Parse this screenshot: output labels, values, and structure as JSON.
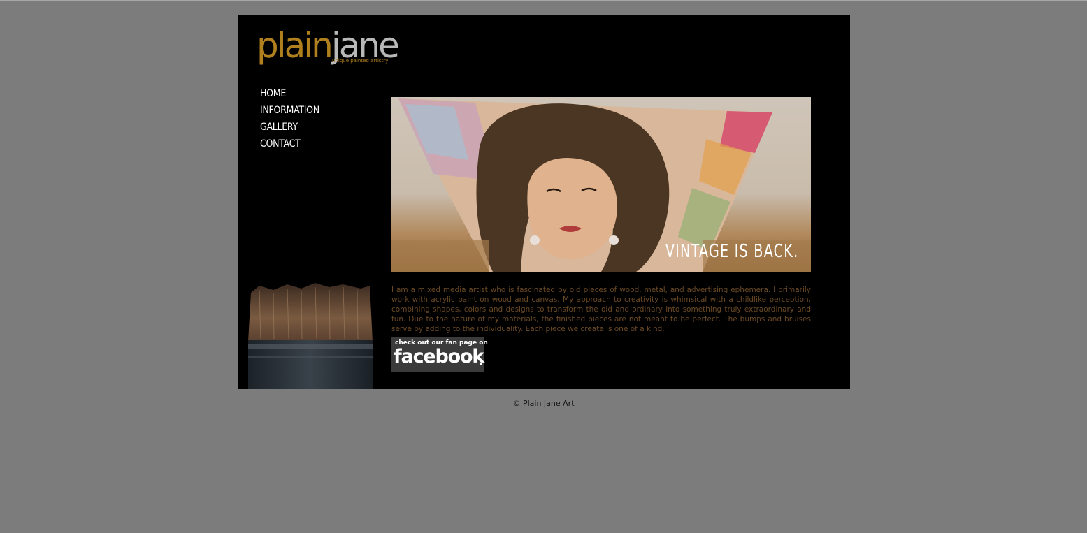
{
  "logo": {
    "word_plain": "plain",
    "word_jane": "jane",
    "tagline": "unique painted artistry"
  },
  "nav": {
    "items": [
      {
        "label": "HOME"
      },
      {
        "label": "INFORMATION"
      },
      {
        "label": "GALLERY"
      },
      {
        "label": "CONTACT"
      }
    ]
  },
  "hero": {
    "caption": "VINTAGE IS BACK."
  },
  "intro": {
    "text": "I am a mixed media artist who is fascinated by old pieces of wood, metal, and advertising ephemera. I primarily work with acrylic paint on wood and canvas.  My approach to creativity is whimsical with a childlike perception, combining shapes, colors and designs to transform the old and ordinary into something truly extraordinary and fun.  Due to the nature of my materials, the finished pieces are not meant to be perfect. The bumps and bruises serve by adding to the individuality. Each piece we create is one of a kind."
  },
  "facebook": {
    "line1": "check out our fan page on",
    "line2": "facebook"
  },
  "footer": {
    "text": "© Plain Jane Art"
  },
  "colors": {
    "background": "#7c7c7c",
    "page": "#000000",
    "logo_gold": "#b0801e",
    "logo_gray": "#b8b8b8",
    "intro_text": "#6b4a26",
    "nav_text": "#ffffff"
  }
}
